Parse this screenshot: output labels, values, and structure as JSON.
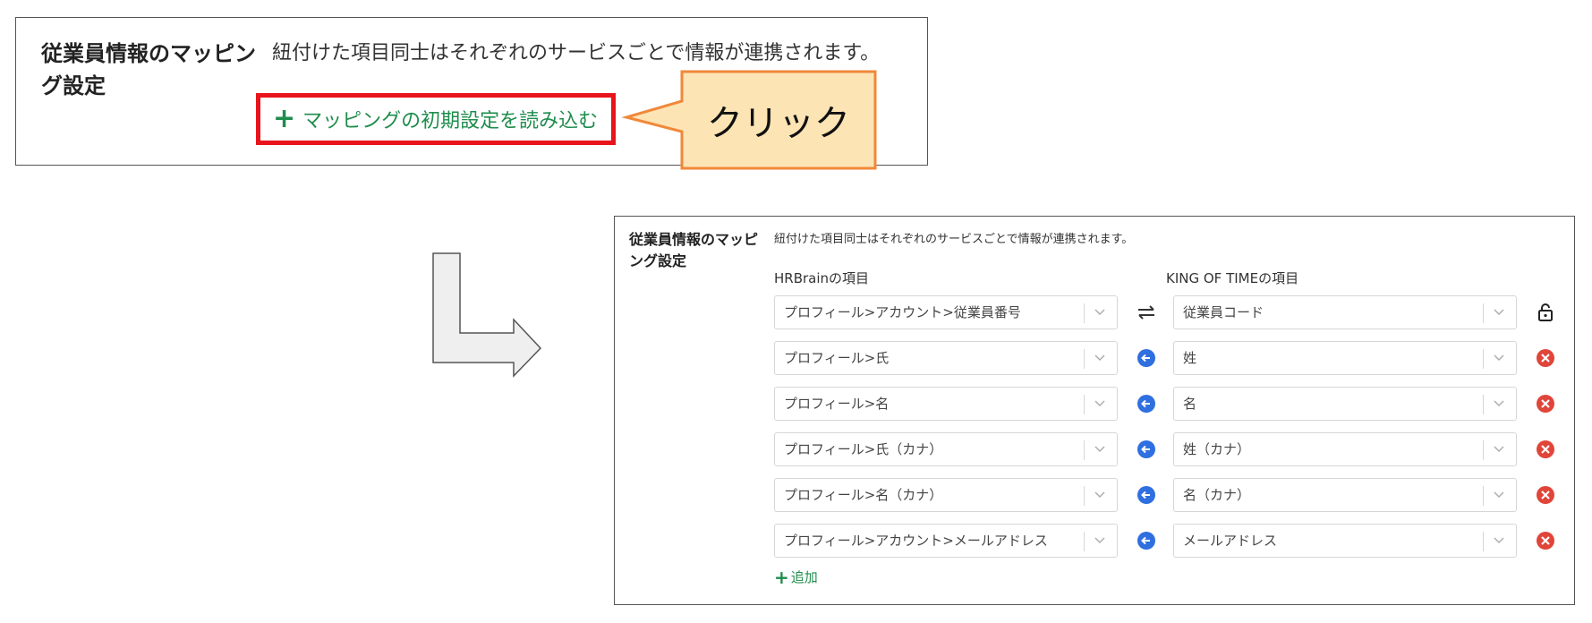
{
  "top_panel": {
    "title": "従業員情報のマッピング設定",
    "description": "紐付けた項目同士はそれぞれのサービスごとで情報が連携されます。",
    "load_button_icon": "plus-icon",
    "load_button_label": "マッピングの初期設定を読み込む",
    "callout_text": "クリック"
  },
  "bottom_panel": {
    "title": "従業員情報のマッピング設定",
    "description": "紐付けた項目同士はそれぞれのサービスごとで情報が連携されます。",
    "left_header": "HRBrainの項目",
    "right_header": "KING OF TIMEの項目",
    "rows": [
      {
        "left": "プロフィール>アカウント>従業員番号",
        "right": "従業員コード",
        "link_icon": "swap-arrows-icon",
        "end_icon": "lock-icon"
      },
      {
        "left": "プロフィール>氏",
        "right": "姓",
        "link_icon": "arrow-left-circle-icon",
        "end_icon": "remove-circle-icon"
      },
      {
        "left": "プロフィール>名",
        "right": "名",
        "link_icon": "arrow-left-circle-icon",
        "end_icon": "remove-circle-icon"
      },
      {
        "left": "プロフィール>氏（カナ）",
        "right": "姓（カナ）",
        "link_icon": "arrow-left-circle-icon",
        "end_icon": "remove-circle-icon"
      },
      {
        "left": "プロフィール>名（カナ）",
        "right": "名（カナ）",
        "link_icon": "arrow-left-circle-icon",
        "end_icon": "remove-circle-icon"
      },
      {
        "left": "プロフィール>アカウント>メールアドレス",
        "right": "メールアドレス",
        "link_icon": "arrow-left-circle-icon",
        "end_icon": "remove-circle-icon"
      }
    ],
    "add_label": "追加"
  },
  "colors": {
    "accent_green": "#1f8d4d",
    "highlight_red": "#e8141c",
    "callout_fill": "#fde4b4",
    "callout_border": "#f0883a",
    "link_blue": "#2f6fe0",
    "remove_red": "#e0453a"
  }
}
